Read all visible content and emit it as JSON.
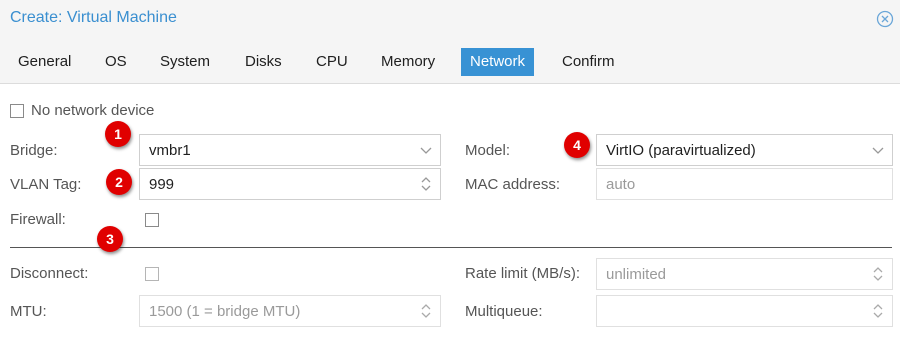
{
  "window": {
    "title": "Create: Virtual Machine"
  },
  "tabs": [
    {
      "label": "General"
    },
    {
      "label": "OS"
    },
    {
      "label": "System"
    },
    {
      "label": "Disks"
    },
    {
      "label": "CPU"
    },
    {
      "label": "Memory"
    },
    {
      "label": "Network",
      "active": true
    },
    {
      "label": "Confirm"
    }
  ],
  "form": {
    "no_network_label": "No network device",
    "no_network_checked": false,
    "bridge": {
      "label": "Bridge:",
      "value": "vmbr1"
    },
    "vlan": {
      "label": "VLAN Tag:",
      "value": "999"
    },
    "firewall": {
      "label": "Firewall:",
      "checked": false
    },
    "model": {
      "label": "Model:",
      "value": "VirtIO (paravirtualized)"
    },
    "mac": {
      "label": "MAC address:",
      "placeholder": "auto"
    },
    "disconnect": {
      "label": "Disconnect:",
      "checked": false
    },
    "mtu": {
      "label": "MTU:",
      "placeholder": "1500 (1 = bridge MTU)"
    },
    "rate_limit": {
      "label": "Rate limit (MB/s):",
      "placeholder": "unlimited"
    },
    "multiqueue": {
      "label": "Multiqueue:",
      "value": ""
    }
  },
  "markers": [
    "1",
    "2",
    "3",
    "4"
  ],
  "icons": {
    "close": "close-circle-icon",
    "dropdown": "chevron-down-icon",
    "spinner": "spinner-arrows-icon"
  },
  "colors": {
    "accent": "#3892d4",
    "title": "#3a8fd0",
    "marker": "#e00000"
  }
}
